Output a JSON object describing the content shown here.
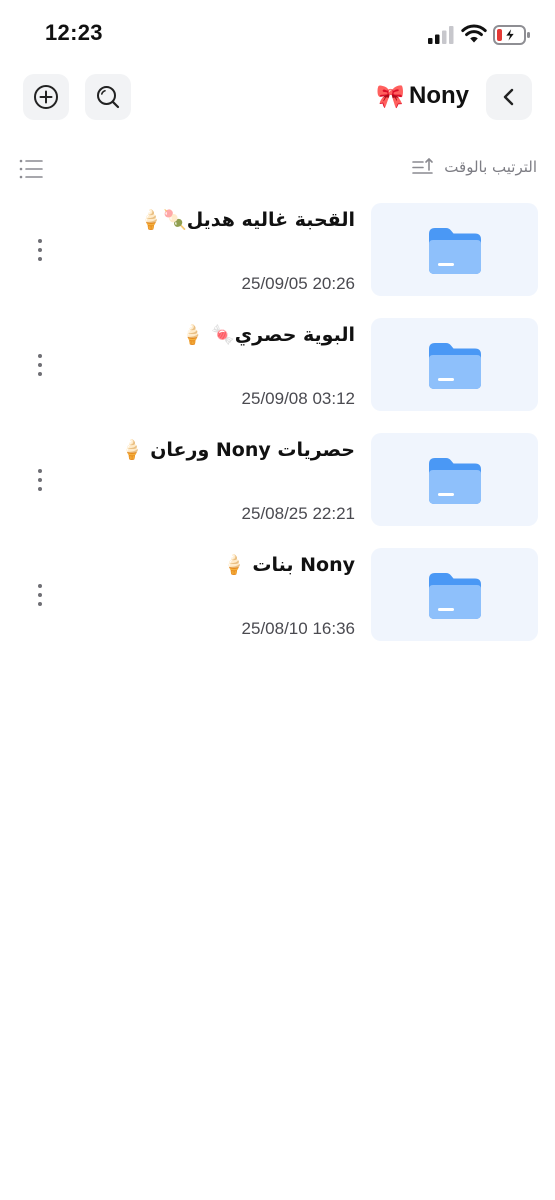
{
  "status_bar": {
    "time": "12:23",
    "icons": [
      "signal-icon",
      "wifi-icon",
      "battery-charging-icon"
    ],
    "battery_low_color": "#e53935"
  },
  "header": {
    "title": "Nony",
    "title_emoji": "🎀",
    "left_buttons": [
      "add-icon",
      "search-icon"
    ],
    "right_button": "back-icon"
  },
  "sort": {
    "label": "الترتيب بالوقت",
    "icon": "sort-ascending-icon",
    "view_icon": "list-view-icon"
  },
  "files": [
    {
      "title": "القحبة غاليه هديل🍡🍦",
      "date": "25/09/05 20:26"
    },
    {
      "title": "البوية حصري🍬 🍦",
      "date": "25/09/08 03:12"
    },
    {
      "title": "حصريات Nony ورعان 🍦",
      "date": "25/08/25 22:21"
    },
    {
      "title": "Nony بنات 🍦",
      "date": "25/08/10 16:36"
    }
  ],
  "colors": {
    "folder_blue": "#4a98f5",
    "folder_thumb_bg": "#f0f5fd",
    "button_bg": "#f2f3f5",
    "secondary_text": "#7d7d84"
  }
}
